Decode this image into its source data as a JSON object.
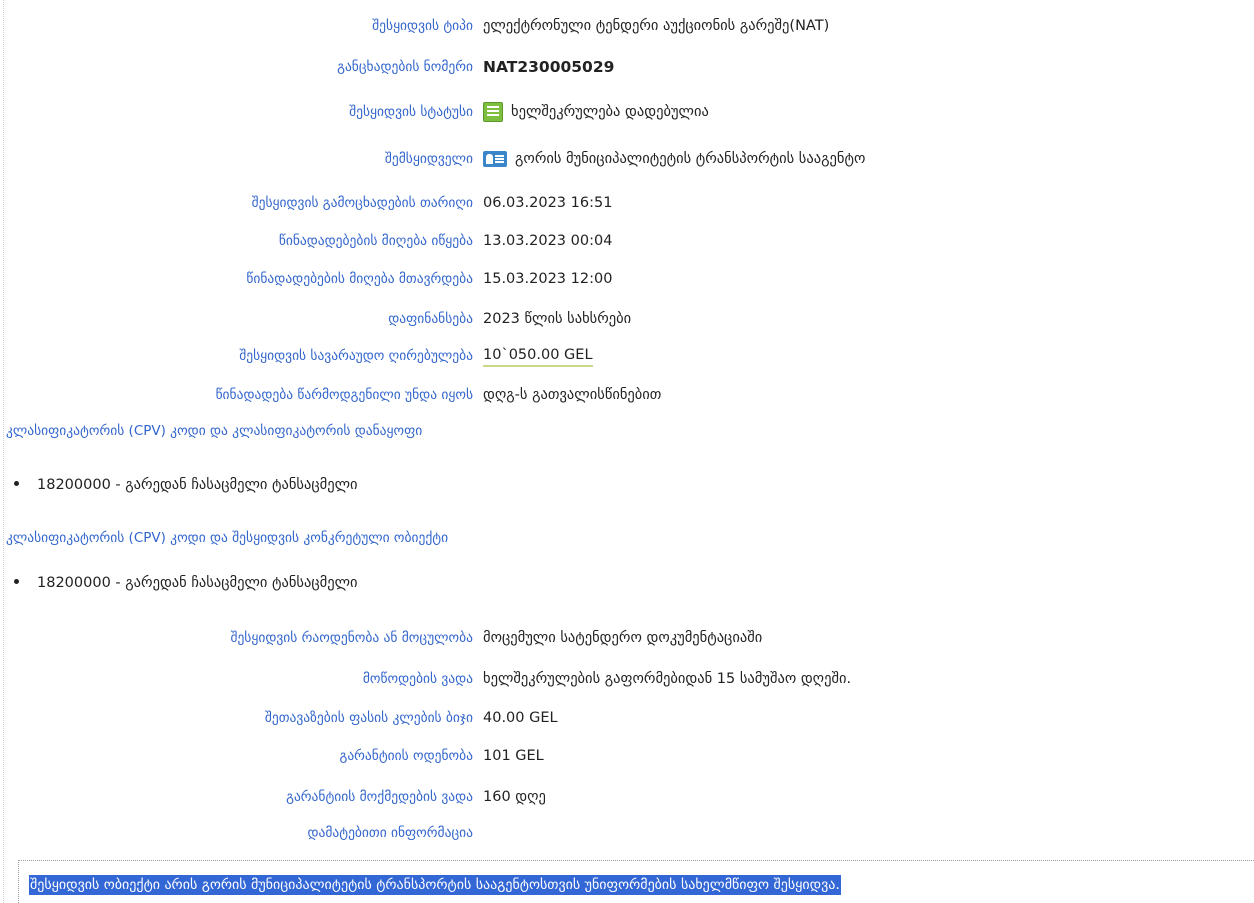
{
  "details": {
    "type_label": "შესყიდვის ტიპი",
    "type_value": "ელექტრონული ტენდერი აუქციონის გარეშე(NAT)",
    "number_label": "განცხადების ნომერი",
    "number_value": "NAT230005029",
    "status_label": "შესყიდვის სტატუსი",
    "status_value": "ხელშეკრულება დადებულია",
    "buyer_label": "შემსყიდველი",
    "buyer_value": "გორის მუნიციპალიტეტის ტრანსპორტის სააგენტო",
    "announce_label": "შესყიდვის გამოცხადების თარიღი",
    "announce_value": "06.03.2023 16:51",
    "offers_start_label": "წინადადებების მიღება იწყება",
    "offers_start_value": "13.03.2023 00:04",
    "offers_end_label": "წინადადებების მიღება მთავრდება",
    "offers_end_value": "15.03.2023 12:00",
    "funding_label": "დაფინანსება",
    "funding_value": "2023 წლის სახსრები",
    "estimated_value_label": "შესყიდვის სავარაუდო ღირებულება",
    "estimated_value": "10`050.00 GEL",
    "vat_label": "წინადადება წარმოდგენილი უნდა იყოს",
    "vat_value": "დღგ-ს გათვალისწინებით"
  },
  "cpv_sections": [
    {
      "heading": "კლასიფიკატორის (CPV) კოდი და კლასიფიკატორის დანაყოფი",
      "item": "18200000 - გარედან ჩასაცმელი ტანსაცმელი"
    },
    {
      "heading": "კლასიფიკატორის (CPV) კოდი და შესყიდვის კონკრეტული ობიექტი",
      "item": "18200000 - გარედან ჩასაცმელი ტანსაცმელი"
    }
  ],
  "details2": {
    "quantity_label": "შესყიდვის რაოდენობა ან მოცულობა",
    "quantity_value": "მოცემული სატენდერო დოკუმენტაციაში",
    "delivery_label": "მოწოდების ვადა",
    "delivery_value": "ხელშეკრულების გაფორმებიდან 15 სამუშაო დღეში.",
    "step_label": "შეთავაზების ფასის კლების ბიჯი",
    "step_value": "40.00 GEL",
    "guarantee_label": "გარანტიის ოდენობა",
    "guarantee_value": "101 GEL",
    "guarantee_term_label": "გარანტიის მოქმედების ვადა",
    "guarantee_term_value": "160 დღე",
    "extra_label": "დამატებითი ინფორმაცია"
  },
  "additional_info_text": "შესყიდვის ობიექტი არის გორის მუნიციპალიტეტის ტრანსპორტის სააგენტოსთვის უნიფორმების სახელმწიფო შესყიდვა.",
  "colors": {
    "label": "#3366cc",
    "highlight": "#3367d6",
    "price_underline": "#c8d98a",
    "status_icon": "#7fbf3f",
    "buyer_icon": "#3a86c8"
  },
  "icons": {
    "status": "contract-icon",
    "buyer": "buyer-card-icon"
  }
}
